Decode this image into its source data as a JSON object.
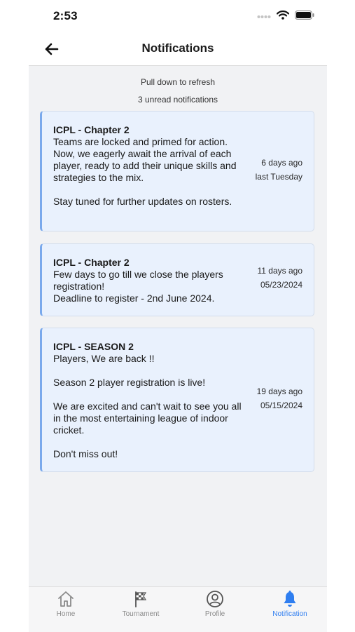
{
  "status_bar": {
    "time": "2:53"
  },
  "header": {
    "title": "Notifications"
  },
  "info": {
    "refresh_hint": "Pull down to refresh",
    "unread_count": "3 unread notifications"
  },
  "notifications": [
    {
      "title": "ICPL - Chapter 2",
      "body": "Teams are locked and primed for action. Now, we eagerly await the arrival of each player, ready to add their unique skills and strategies to the mix.\n\nStay tuned for further updates on rosters.",
      "relative_time": "6 days ago",
      "date": "last Tuesday"
    },
    {
      "title": "ICPL - Chapter 2",
      "body": "Few days to go till we close the players registration!\nDeadline to register - 2nd June 2024.",
      "relative_time": "11 days ago",
      "date": "05/23/2024"
    },
    {
      "title": "ICPL - SEASON 2",
      "body": "Players, We are back !!\n\nSeason 2 player registration is live!\n\nWe are excited and can't wait to see you all in the most entertaining league of indoor cricket.\n\nDon't miss out!",
      "relative_time": "19 days ago",
      "date": "05/15/2024"
    }
  ],
  "tabs": [
    {
      "label": "Home",
      "icon": "home-icon"
    },
    {
      "label": "Tournament",
      "icon": "checkered-flag-icon"
    },
    {
      "label": "Profile",
      "icon": "user-circle-icon"
    },
    {
      "label": "Notification",
      "icon": "bell-icon"
    }
  ],
  "active_tab": "Notification",
  "colors": {
    "accent": "#2f7ef0",
    "card_background": "#e9f1fd",
    "card_border": "#7aa9ec",
    "page_background": "#f1f2f4"
  }
}
